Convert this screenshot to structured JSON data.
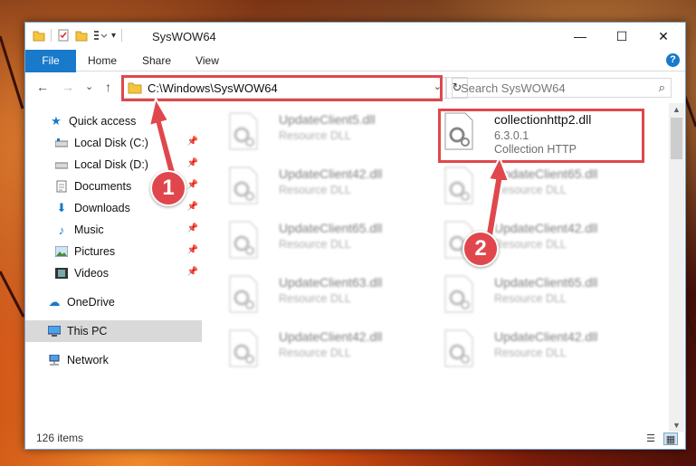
{
  "window": {
    "title": "SysWOW64",
    "controls": {
      "minimize": "—",
      "maximize": "☐",
      "close": "✕"
    }
  },
  "ribbon": {
    "tabs": [
      "File",
      "Home",
      "Share",
      "View"
    ],
    "help_label": "?"
  },
  "navigation": {
    "back": "←",
    "forward": "→",
    "recent": "⌄",
    "up": "↑",
    "address": "C:\\Windows\\SysWOW64",
    "address_dropdown": "⌄",
    "refresh": "↻",
    "search_placeholder": "Search SysWOW64",
    "search_icon": "⌕"
  },
  "sidebar": {
    "items": [
      {
        "label": "Quick access",
        "icon": "star-icon",
        "pinned": false
      },
      {
        "label": "Local Disk (C:)",
        "icon": "drive-icon",
        "pinned": true
      },
      {
        "label": "Local Disk (D:)",
        "icon": "drive-icon",
        "pinned": true
      },
      {
        "label": "Documents",
        "icon": "documents-icon",
        "pinned": true
      },
      {
        "label": "Downloads",
        "icon": "downloads-icon",
        "pinned": true
      },
      {
        "label": "Music",
        "icon": "music-icon",
        "pinned": true
      },
      {
        "label": "Pictures",
        "icon": "pictures-icon",
        "pinned": true
      },
      {
        "label": "Videos",
        "icon": "videos-icon",
        "pinned": true
      },
      {
        "label": "OneDrive",
        "icon": "cloud-icon",
        "pinned": false
      },
      {
        "label": "This PC",
        "icon": "computer-icon",
        "pinned": false
      },
      {
        "label": "Network",
        "icon": "network-icon",
        "pinned": false
      }
    ]
  },
  "files": {
    "col1": [
      {
        "name": "UpdateClient5.dll",
        "type": "Resource DLL"
      },
      {
        "name": "UpdateClient42.dll",
        "type": "Resource DLL"
      },
      {
        "name": "UpdateClient65.dll",
        "type": "Resource DLL"
      },
      {
        "name": "UpdateClient63.dll",
        "type": "Resource DLL"
      },
      {
        "name": "UpdateClient42.dll",
        "type": "Resource DLL"
      }
    ],
    "col2": [
      {
        "name": "collectionhttp2.dll",
        "version": "6.3.0.1",
        "type": "Collection HTTP"
      },
      {
        "name": "UpdateClient65.dll",
        "type": "Resource DLL"
      },
      {
        "name": "UpdateClient42.dll",
        "type": "Resource DLL"
      },
      {
        "name": "UpdateClient65.dll",
        "type": "Resource DLL"
      },
      {
        "name": "UpdateClient42.dll",
        "type": "Resource DLL"
      }
    ]
  },
  "status": {
    "item_count": "126 items"
  },
  "annotations": {
    "step1": "1",
    "step2": "2"
  },
  "colors": {
    "accent": "#1979ca",
    "highlight": "#e0474c"
  }
}
